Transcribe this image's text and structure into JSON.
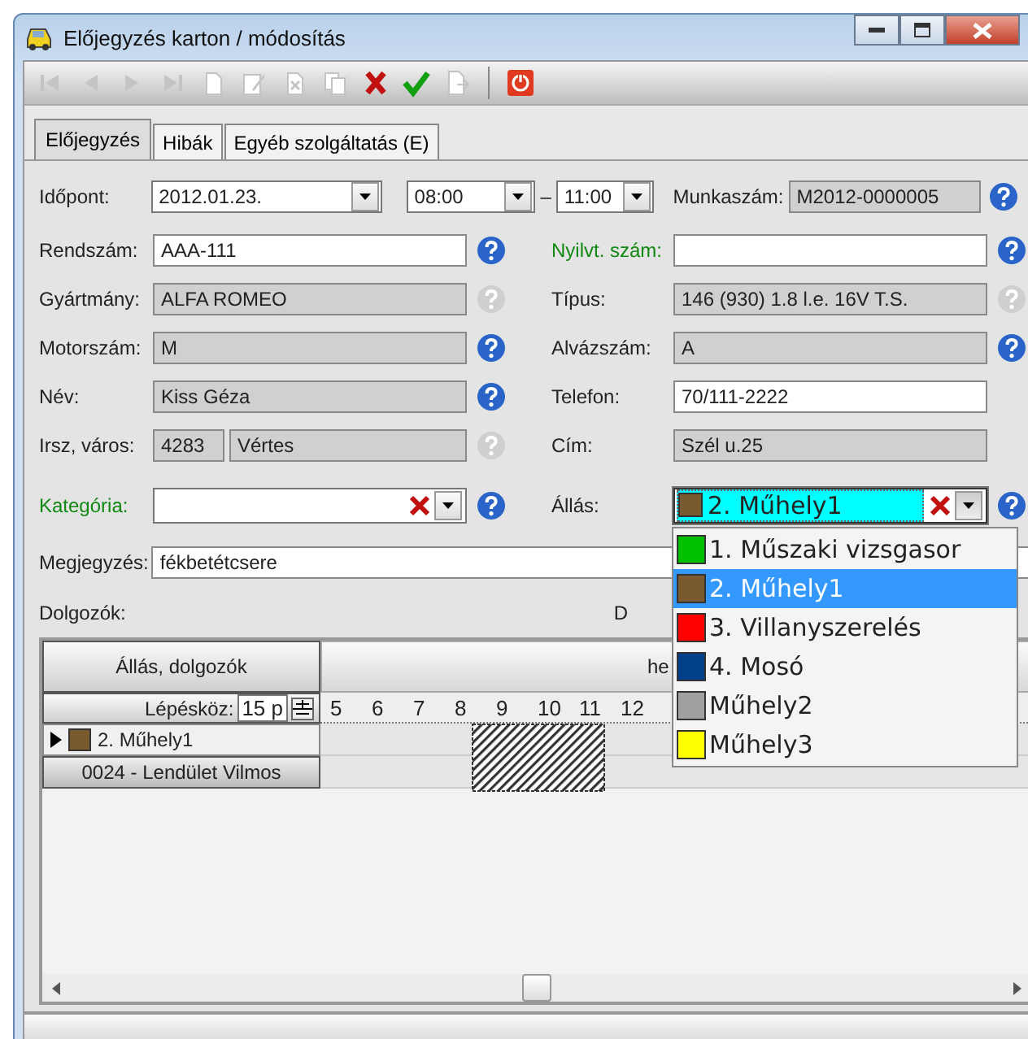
{
  "window": {
    "title": "Előjegyzés karton / módosítás"
  },
  "toolbar": [
    {
      "kind": "first",
      "disabled": true
    },
    {
      "kind": "prev",
      "disabled": true
    },
    {
      "kind": "next",
      "disabled": true
    },
    {
      "kind": "last",
      "disabled": true
    },
    {
      "kind": "new",
      "disabled": true
    },
    {
      "kind": "edit",
      "disabled": true
    },
    {
      "kind": "delete",
      "disabled": true
    },
    {
      "kind": "copy",
      "disabled": true
    },
    {
      "kind": "cancel",
      "disabled": false
    },
    {
      "kind": "save",
      "disabled": false
    },
    {
      "kind": "export",
      "disabled": true
    },
    {
      "kind": "separator"
    },
    {
      "kind": "power",
      "disabled": false
    }
  ],
  "tabs": [
    {
      "label": "Előjegyzés",
      "selected": true
    },
    {
      "label": "Hibák",
      "selected": false
    },
    {
      "label": "Egyéb szolgáltatás (E)",
      "selected": false
    }
  ],
  "appointment": {
    "label": "Időpont:",
    "date": "2012.01.23.",
    "from": "08:00",
    "dash": "–",
    "to": "11:00"
  },
  "work_number": {
    "label": "Munkaszám:",
    "value": "M2012-0000005",
    "help_enabled": true
  },
  "left_fields": [
    {
      "label": "Rendszám:",
      "values": [
        "AAA-111"
      ],
      "editable": true,
      "required": false,
      "help_enabled": true
    },
    {
      "label": "Gyártmány:",
      "values": [
        "ALFA ROMEO"
      ],
      "editable": false,
      "required": false,
      "help_enabled": false
    },
    {
      "label": "Motorszám:",
      "values": [
        "M"
      ],
      "editable": false,
      "required": false,
      "help_enabled": true
    },
    {
      "label": "Név:",
      "values": [
        "Kiss Géza"
      ],
      "editable": false,
      "required": false,
      "help_enabled": true
    },
    {
      "label": "Irsz, város:",
      "values": [
        "4283",
        "Vértes"
      ],
      "editable": false,
      "required": false,
      "help_enabled": false
    }
  ],
  "right_fields": [
    {
      "label": "Nyilvt. szám:",
      "editable": true,
      "required": true,
      "help_enabled": true
    },
    {
      "label": "Típus:",
      "values": [
        "146 (930) 1.8 l.e. 16V T.S."
      ],
      "editable": false,
      "required": false,
      "help_enabled": false
    },
    {
      "label": "Alvázszám:",
      "values": [
        "A"
      ],
      "editable": false,
      "required": false,
      "help_enabled": true
    },
    {
      "label": "Telefon:",
      "values": [
        "70/111-2222"
      ],
      "editable": true,
      "required": false
    },
    {
      "label": "Cím:",
      "values": [
        "Szél u.25"
      ],
      "editable": false,
      "required": false
    }
  ],
  "category": {
    "label": "Kategória:",
    "required": true,
    "help_enabled": true
  },
  "station": {
    "label": "Állás:",
    "value": "2. Műhely1",
    "color": "#7a5a30",
    "help_enabled": true,
    "expanded": true,
    "options": [
      {
        "label": "1. Műszaki vizsgasor",
        "color": "#00c000",
        "selected": false
      },
      {
        "label": "2. Műhely1",
        "color": "#7a5a30",
        "selected": true
      },
      {
        "label": "3. Villanyszerelés",
        "color": "#ff0000",
        "selected": false
      },
      {
        "label": "4. Mosó",
        "color": "#003f8a",
        "selected": false
      },
      {
        "label": "Műhely2",
        "color": "#a0a0a0",
        "selected": false
      },
      {
        "label": "Műhely3",
        "color": "#ffff00",
        "selected": false
      }
    ]
  },
  "note": {
    "label": "Megjegyzés:",
    "value": "fékbetétcsere"
  },
  "workers": {
    "label": "Dolgozók:",
    "label_2": "D"
  },
  "schedule": {
    "columns": [
      "Állás, dolgozók",
      "he"
    ],
    "step_label": "Lépésköz:",
    "step_value": "15 p",
    "ticks": [
      "5",
      "6",
      "7",
      "8",
      "9",
      "10",
      "11",
      "12"
    ],
    "rows": [
      {
        "kind": "group",
        "label": "2. Műhely1",
        "color": "#7a5a30"
      },
      {
        "kind": "worker",
        "label": "0024 - Lendület Vilmos"
      }
    ]
  }
}
